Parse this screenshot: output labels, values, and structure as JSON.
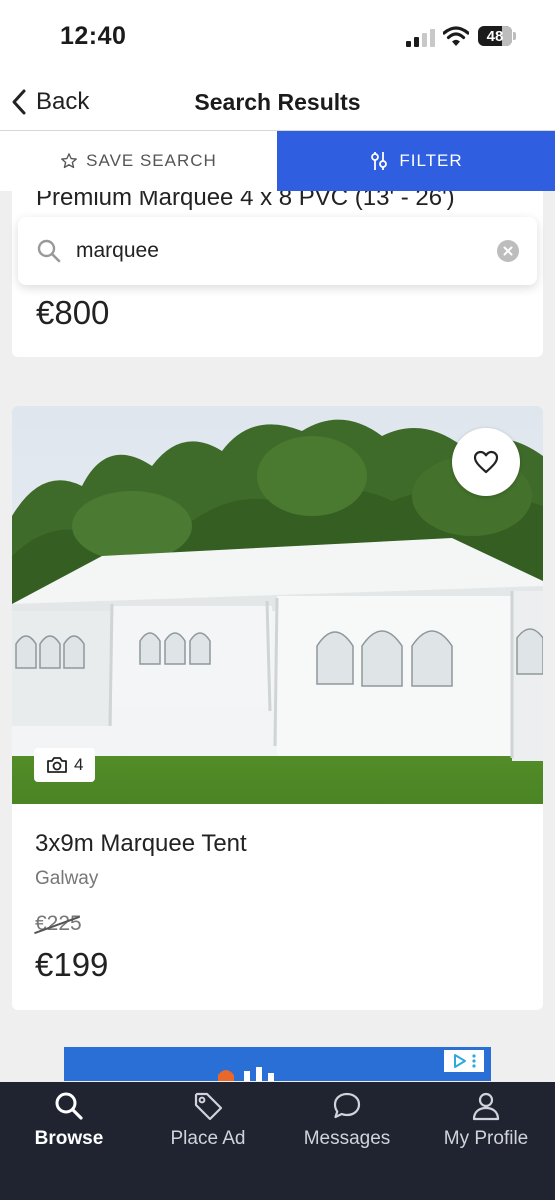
{
  "status_bar": {
    "time": "12:40",
    "battery": "48"
  },
  "nav": {
    "back_label": "Back",
    "title": "Search Results"
  },
  "actions": {
    "save_search": "SAVE SEARCH",
    "filter": "FILTER"
  },
  "search": {
    "query": "marquee"
  },
  "listings": [
    {
      "title": "Premium Marquee 4 x 8 PVC (13' - 26')",
      "price": "€800"
    },
    {
      "title": "3x9m Marquee Tent",
      "location": "Galway",
      "old_price": "€225",
      "price": "€199",
      "photo_count": "4"
    }
  ],
  "tabs": [
    {
      "label": "Browse",
      "icon": "search-icon",
      "active": true
    },
    {
      "label": "Place Ad",
      "icon": "tag-icon",
      "active": false
    },
    {
      "label": "Messages",
      "icon": "chat-bubble-icon",
      "active": false
    },
    {
      "label": "My Profile",
      "icon": "person-icon",
      "active": false
    }
  ],
  "colors": {
    "accent": "#2f5fe0",
    "tabbar": "#1f2430",
    "background": "#efefef"
  }
}
